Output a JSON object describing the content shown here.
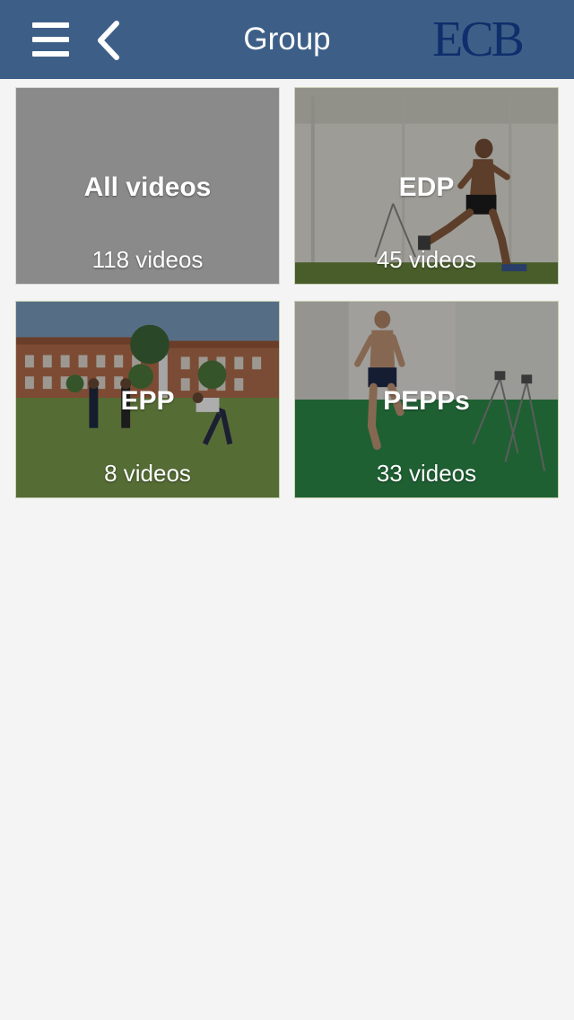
{
  "navbar": {
    "title": "Group",
    "menu_icon": "hamburger-menu-icon",
    "back_icon": "chevron-left-icon",
    "logo_text": "ECB",
    "background_color": "#3d5f87",
    "logo_color": "#0e2f6c"
  },
  "groups": [
    {
      "title": "All videos",
      "count": "118 videos"
    },
    {
      "title": "EDP",
      "count": "45 videos"
    },
    {
      "title": "EPP",
      "count": "8 videos"
    },
    {
      "title": "PEPPs",
      "count": "33 videos"
    }
  ]
}
